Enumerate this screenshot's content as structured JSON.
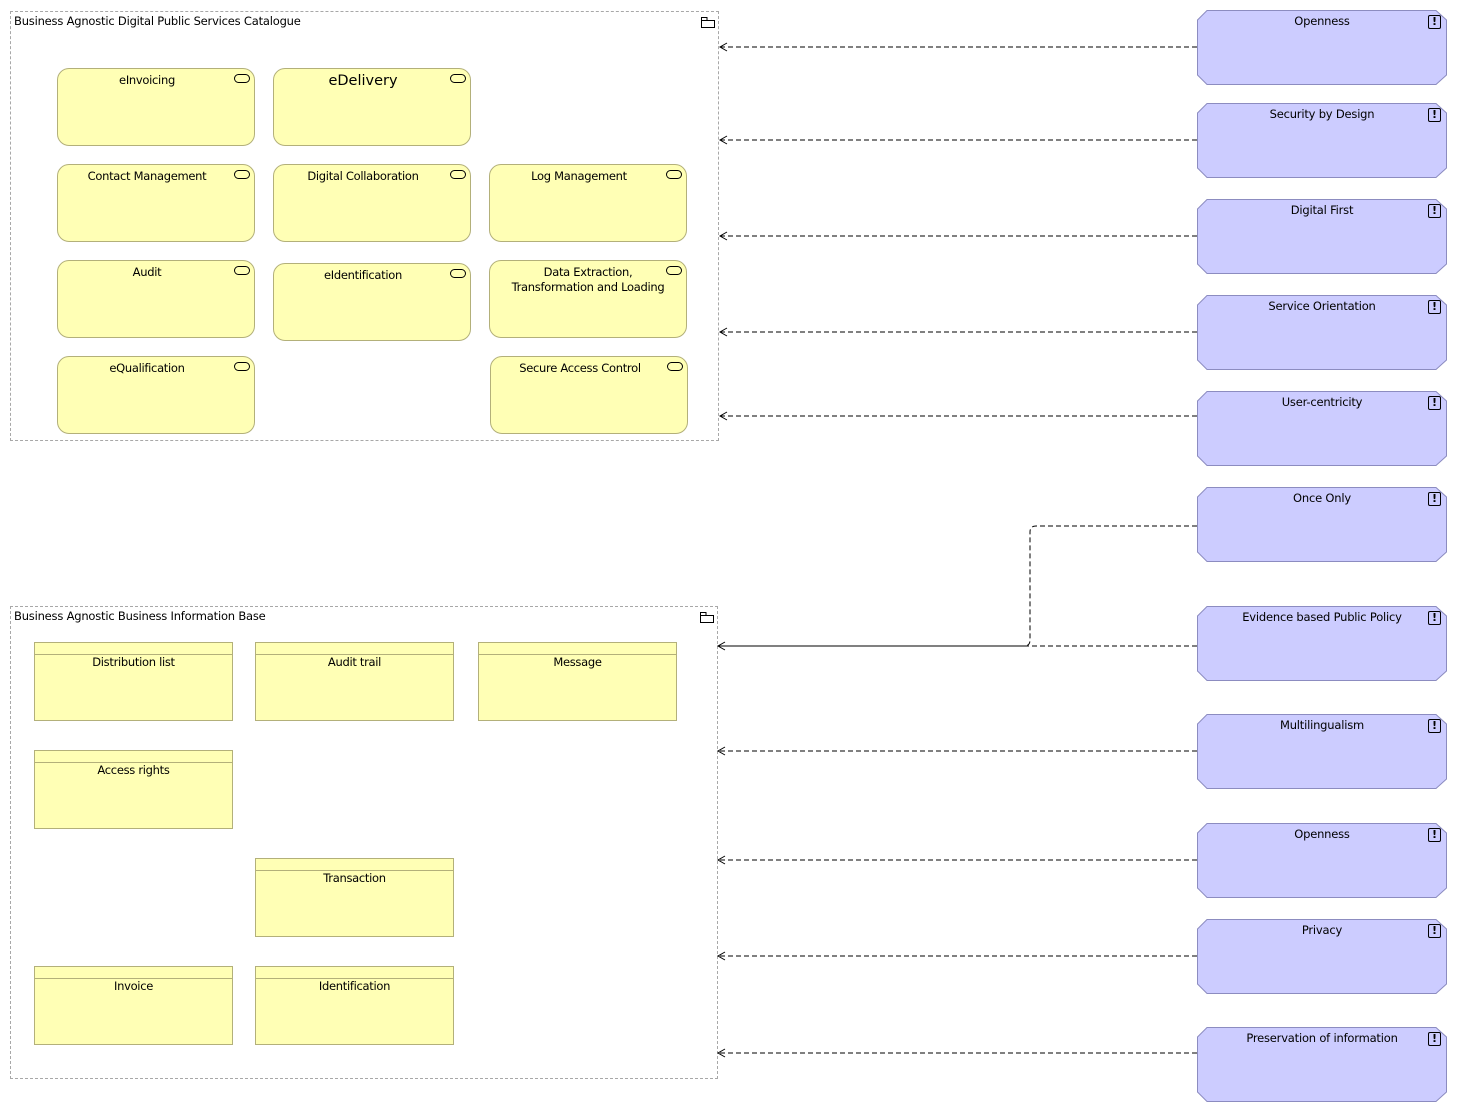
{
  "diagram": {
    "groups": [
      {
        "title": "Business Agnostic Digital Public Services Catalogue",
        "icon": "folder-icon",
        "services": [
          {
            "label": "eInvoicing",
            "icon": "service-icon"
          },
          {
            "label": "eDelivery",
            "icon": "service-icon"
          },
          {
            "label": "Contact Management",
            "icon": "service-icon"
          },
          {
            "label": "Digital Collaboration",
            "icon": "service-icon"
          },
          {
            "label": "Log Management",
            "icon": "service-icon"
          },
          {
            "label": "Audit",
            "icon": "service-icon"
          },
          {
            "label": "eIdentification",
            "icon": "service-icon"
          },
          {
            "label": "Data Extraction, Transformation and Loading",
            "icon": "service-icon"
          },
          {
            "label": "eQualification",
            "icon": "service-icon"
          },
          {
            "label": "Secure Access Control",
            "icon": "service-icon"
          }
        ]
      },
      {
        "title": "Business Agnostic Business Information Base",
        "icon": "folder-icon",
        "objects": [
          {
            "label": "Distribution list"
          },
          {
            "label": "Audit trail"
          },
          {
            "label": "Message"
          },
          {
            "label": "Access rights"
          },
          {
            "label": "Transaction"
          },
          {
            "label": "Invoice"
          },
          {
            "label": "Identification"
          }
        ]
      }
    ],
    "principles": [
      {
        "label": "Openness",
        "icon": "exclamation-icon"
      },
      {
        "label": "Security by Design",
        "icon": "exclamation-icon"
      },
      {
        "label": "Digital First",
        "icon": "exclamation-icon"
      },
      {
        "label": "Service Orientation",
        "icon": "exclamation-icon"
      },
      {
        "label": "User-centricity",
        "icon": "exclamation-icon"
      },
      {
        "label": "Once Only",
        "icon": "exclamation-icon"
      },
      {
        "label": "Evidence based Public Policy",
        "icon": "exclamation-icon"
      },
      {
        "label": "Multilingualism",
        "icon": "exclamation-icon"
      },
      {
        "label": "Openness",
        "icon": "exclamation-icon"
      },
      {
        "label": "Privacy",
        "icon": "exclamation-icon"
      },
      {
        "label": "Preservation of information",
        "icon": "exclamation-icon"
      }
    ],
    "relationships": [
      {
        "from": "Openness",
        "to": "Business Agnostic Digital Public Services Catalogue",
        "type": "influence"
      },
      {
        "from": "Security by Design",
        "to": "Business Agnostic Digital Public Services Catalogue",
        "type": "influence"
      },
      {
        "from": "Digital First",
        "to": "Business Agnostic Digital Public Services Catalogue",
        "type": "influence"
      },
      {
        "from": "Service Orientation",
        "to": "Business Agnostic Digital Public Services Catalogue",
        "type": "influence"
      },
      {
        "from": "User-centricity",
        "to": "Business Agnostic Digital Public Services Catalogue",
        "type": "influence"
      },
      {
        "from": "Once Only",
        "to": "Business Agnostic Business Information Base",
        "type": "influence"
      },
      {
        "from": "Evidence based Public Policy",
        "to": "Business Agnostic Business Information Base",
        "type": "influence"
      },
      {
        "from": "Multilingualism",
        "to": "Business Agnostic Business Information Base",
        "type": "influence"
      },
      {
        "from": "Openness",
        "to": "Business Agnostic Business Information Base",
        "type": "influence"
      },
      {
        "from": "Privacy",
        "to": "Business Agnostic Business Information Base",
        "type": "influence"
      },
      {
        "from": "Preservation of information",
        "to": "Business Agnostic Business Information Base",
        "type": "influence"
      }
    ],
    "colors": {
      "service_fill": "#ffffb5",
      "object_fill": "#ffffb5",
      "element_border": "#b3b07a",
      "principle_fill": "#ccccff",
      "principle_border": "#8c8cc0",
      "group_border": "#a8a8a8"
    }
  }
}
